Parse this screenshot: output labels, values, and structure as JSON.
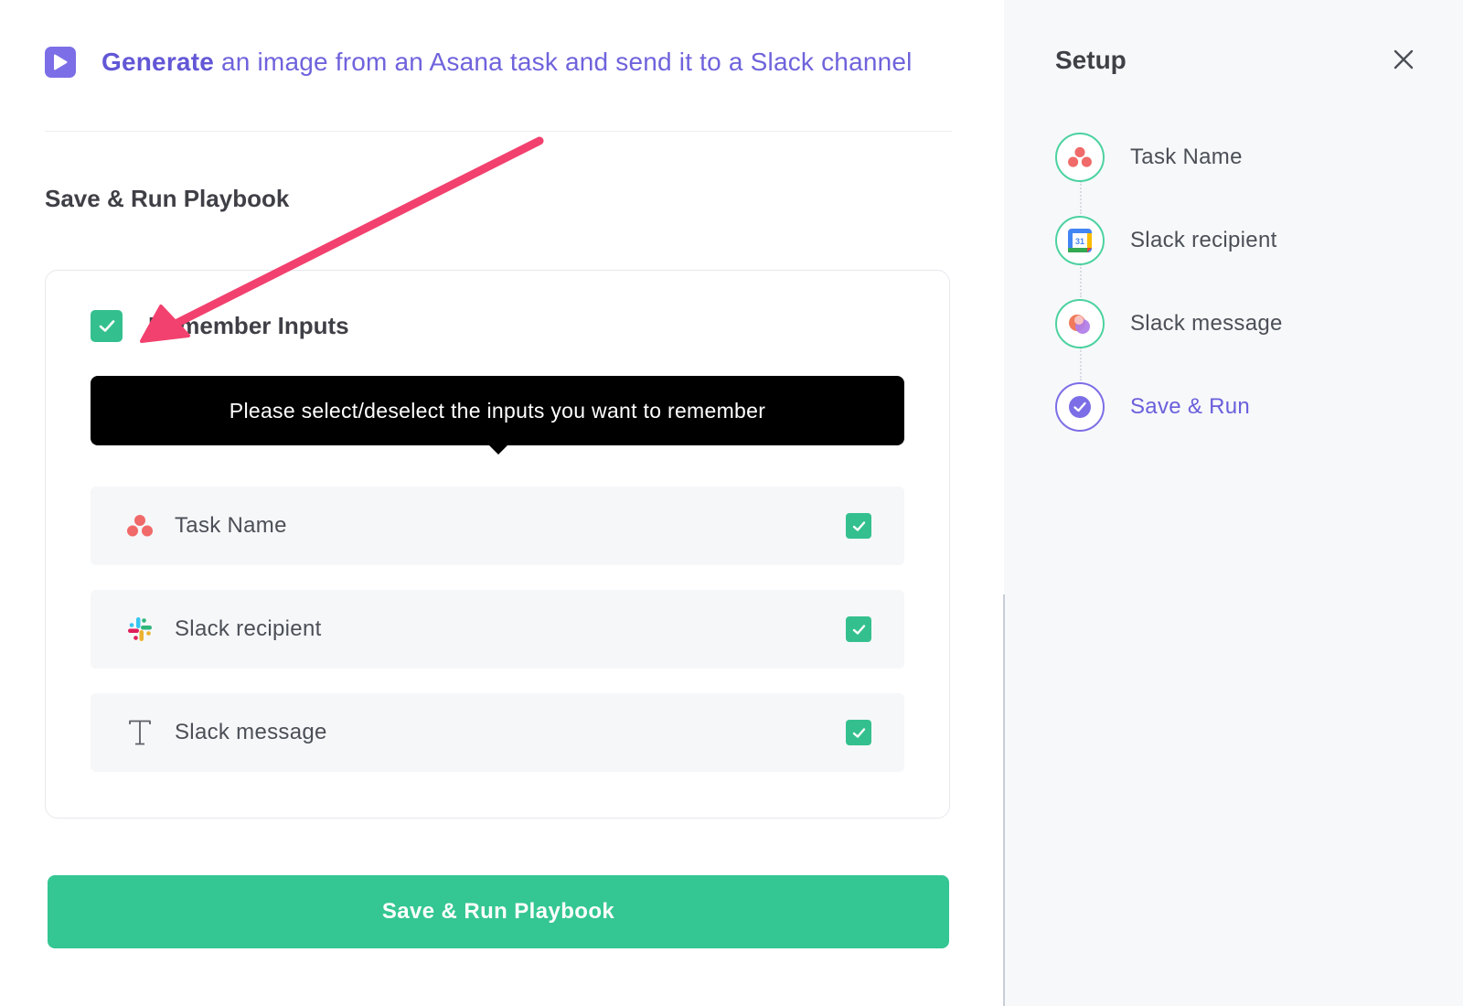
{
  "header": {
    "title_strong": "Generate",
    "title_rest": " an image from an Asana task and send it to a Slack channel",
    "icon": "play-icon",
    "accent": "#6f63dc"
  },
  "main": {
    "section_title": "Save & Run Playbook",
    "remember": {
      "label": "Remember Inputs",
      "checked": true
    },
    "tooltip": "Please select/deselect the inputs you want to remember",
    "inputs": [
      {
        "label": "Task Name",
        "icon": "asana-icon",
        "checked": true
      },
      {
        "label": "Slack recipient",
        "icon": "slack-icon",
        "checked": true
      },
      {
        "label": "Slack message",
        "icon": "text-icon",
        "checked": true
      }
    ],
    "run_button": "Save & Run Playbook",
    "button_color": "#34c693"
  },
  "sidebar": {
    "title": "Setup",
    "close_icon": "close-icon",
    "steps": [
      {
        "label": "Task Name",
        "icon": "asana-icon",
        "state": "complete"
      },
      {
        "label": "Slack recipient",
        "icon": "calendar-icon",
        "state": "complete"
      },
      {
        "label": "Slack message",
        "icon": "app-icon",
        "state": "complete"
      },
      {
        "label": "Save & Run",
        "icon": "check-circle-icon",
        "state": "active"
      }
    ]
  },
  "colors": {
    "check_green": "#34c08e",
    "step_border": "#4cd2a0",
    "active_purple": "#7c6ee6",
    "annotation_arrow": "#f2416e"
  }
}
